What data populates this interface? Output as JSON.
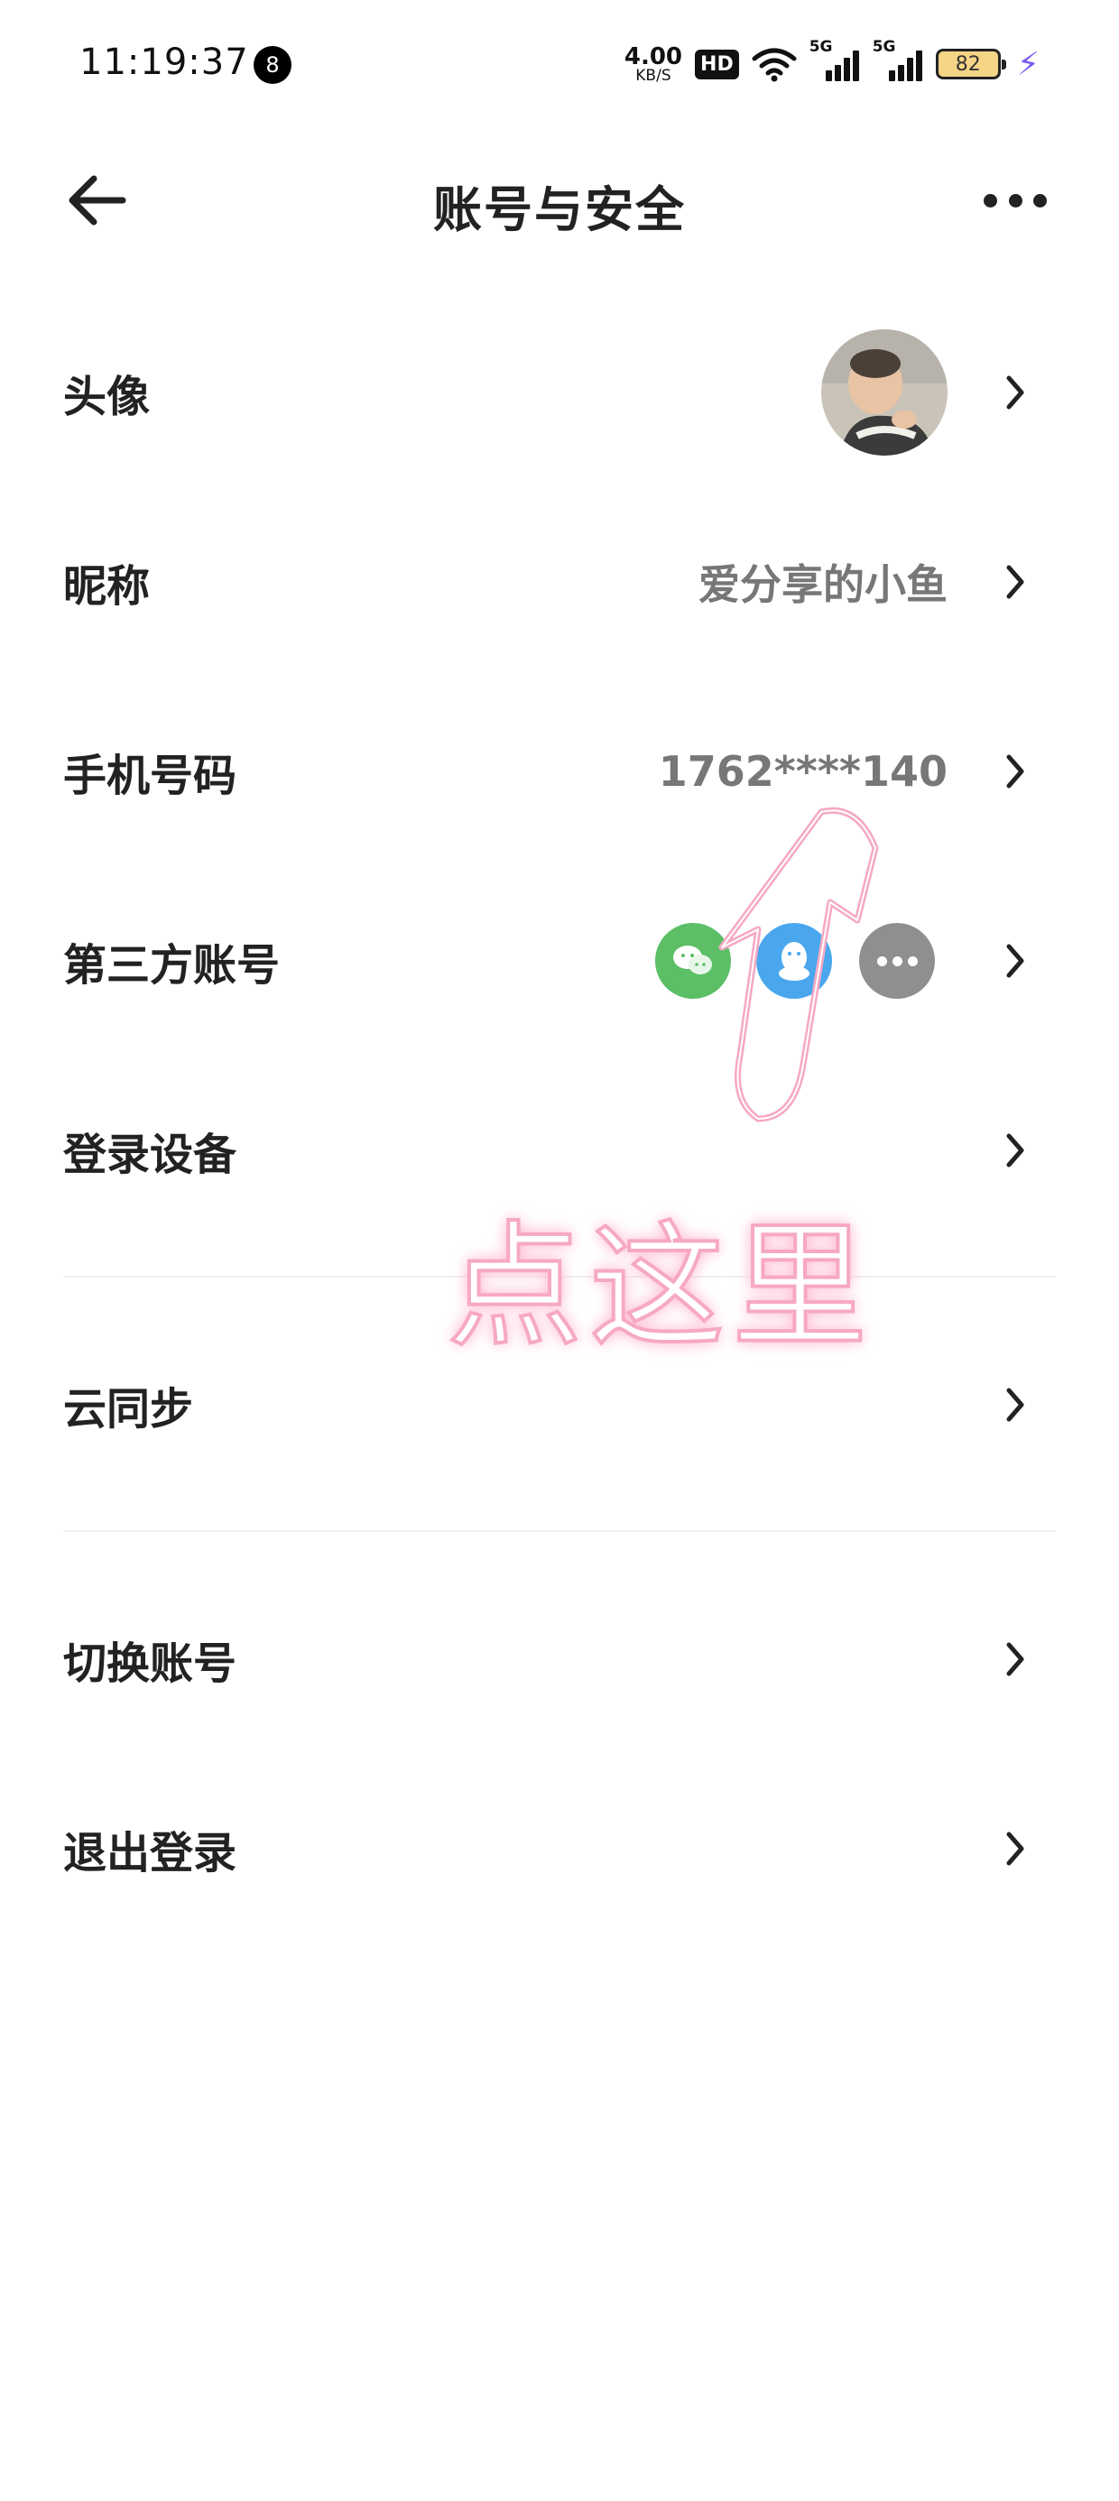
{
  "status_bar": {
    "time": "11:19:37",
    "notification_count": "8",
    "net_speed_value": "4.00",
    "net_speed_unit": "KB/S",
    "hd_label": "HD",
    "signal_1_label": "5G",
    "signal_2_label": "5G",
    "battery_level": "82",
    "battery_color": "#f6d486",
    "charging_color": "#7b5cf0"
  },
  "header": {
    "title": "账号与安全",
    "back_icon": "arrow-left-icon",
    "more_icon": "more-horizontal-icon"
  },
  "rows": {
    "avatar": {
      "label": "头像"
    },
    "nickname": {
      "label": "昵称",
      "value": "爱分享的小鱼"
    },
    "phone": {
      "label": "手机号码",
      "value": "1762****140"
    },
    "third_party": {
      "label": "第三方账号",
      "icons": [
        "wechat-icon",
        "qq-icon",
        "more-icon"
      ],
      "colors": {
        "wechat": "#5cbf66",
        "qq": "#4aa7ee",
        "more": "#8f8f8f"
      }
    },
    "devices": {
      "label": "登录设备"
    },
    "cloud_sync": {
      "label": "云同步"
    },
    "switch_account": {
      "label": "切换账号"
    },
    "logout": {
      "label": "退出登录"
    }
  },
  "annotation": {
    "text": "点这里",
    "color": "#f6a8c4"
  }
}
